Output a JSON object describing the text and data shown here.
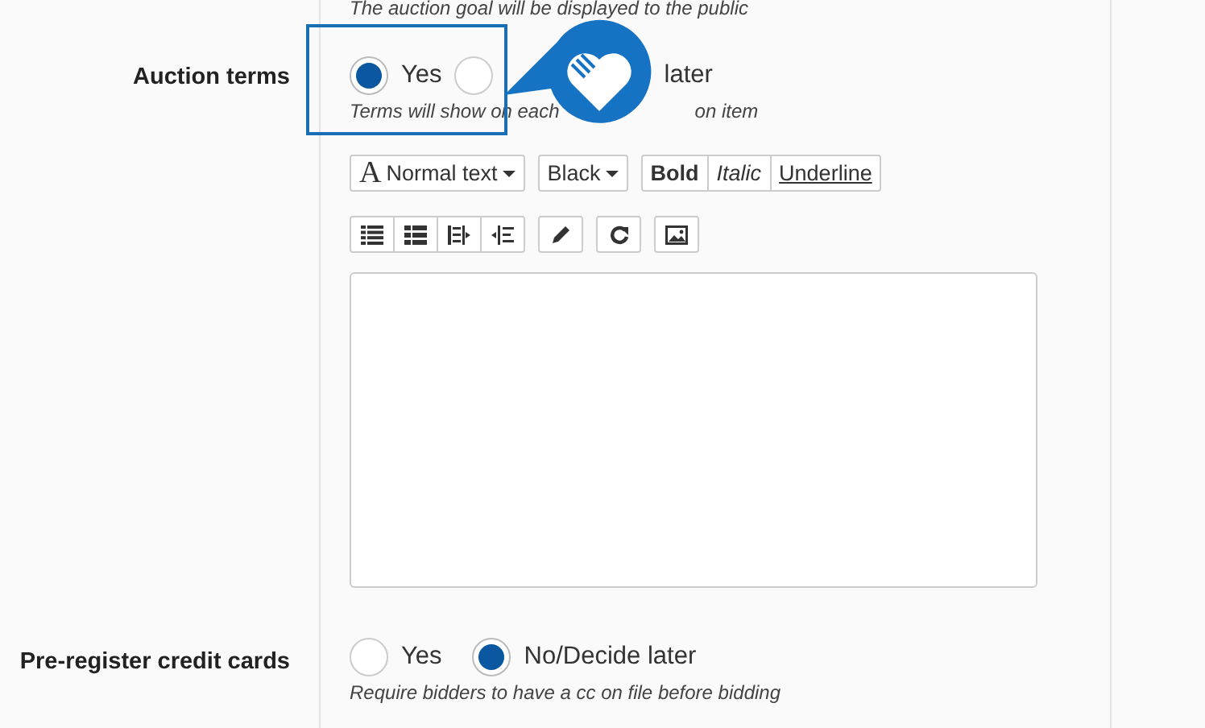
{
  "top_hint": "The auction goal will be displayed to the public",
  "fields": [
    {
      "label": "Auction terms",
      "options": [
        {
          "label": "Yes",
          "selected": true
        },
        {
          "label": "later",
          "selected": false
        }
      ],
      "hint_parts": [
        "Terms will show on each",
        "on item"
      ],
      "editor": {
        "font": {
          "glyph": "A",
          "label": "Normal text"
        },
        "color": {
          "label": "Black"
        },
        "styles": [
          {
            "kind": "bold",
            "label": "Bold"
          },
          {
            "kind": "italic",
            "label": "Italic"
          },
          {
            "kind": "underline",
            "label": "Underline"
          }
        ]
      }
    },
    {
      "label": "Pre-register credit cards",
      "options": [
        {
          "label": "Yes",
          "selected": false
        },
        {
          "label": "No/Decide later",
          "selected": true
        }
      ],
      "hint_parts": [
        "Require bidders to have a cc on file before bidding"
      ]
    }
  ]
}
